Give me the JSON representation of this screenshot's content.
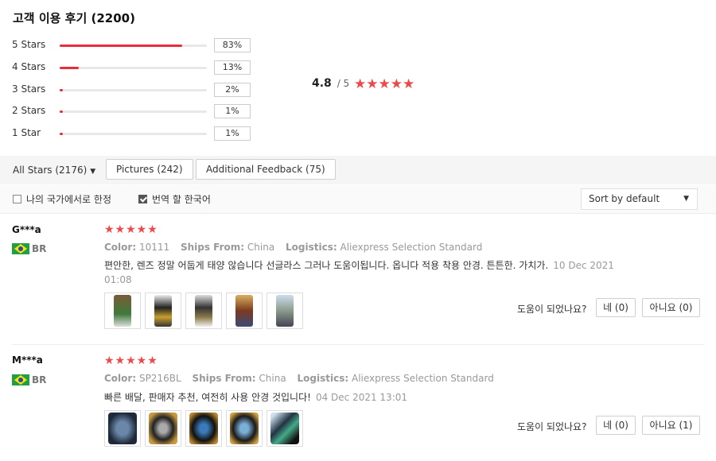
{
  "header": {
    "title": "고객 이용 후기 (2200)"
  },
  "ratings": [
    {
      "label": "5 Stars",
      "percent_text": "83%",
      "fraction": 0.83
    },
    {
      "label": "4 Stars",
      "percent_text": "13%",
      "fraction": 0.13
    },
    {
      "label": "3 Stars",
      "percent_text": "2%",
      "fraction": 0.02
    },
    {
      "label": "2 Stars",
      "percent_text": "1%",
      "fraction": 0.01
    },
    {
      "label": "1 Star",
      "percent_text": "1%",
      "fraction": 0.01
    }
  ],
  "summary": {
    "average": "4.8",
    "out_of": "/ 5",
    "stars": "★★★★★"
  },
  "filters": {
    "all_stars": "All Stars (2176)",
    "pictures": "Pictures (242)",
    "additional": "Additional Feedback (75)"
  },
  "options": {
    "country_only": "나의 국가에서로 한정",
    "country_only_checked": false,
    "translate": "번역 할 한국어",
    "translate_checked": true,
    "sort": "Sort by default"
  },
  "labels": {
    "color": "Color:",
    "ships_from": "Ships From:",
    "logistics": "Logistics:",
    "helpful_q": "도움이 되었나요?"
  },
  "reviews": [
    {
      "name": "G***a",
      "country": "BR",
      "stars": "★★★★★",
      "color": "10111",
      "ships_from": "China",
      "logistics": "Aliexpress Selection Standard",
      "text": "편안한, 렌즈 정말 어둡게 태양 않습니다 선글라스 그러나 도움이됩니다. 옵니다 적용 착용 안경. 튼튼한. 가치가.",
      "date_a": "10 Dec 2021",
      "date_b": "01:08",
      "yes": "네 (0)",
      "no": "아니요 (0)"
    },
    {
      "name": "M***a",
      "country": "BR",
      "stars": "★★★★★",
      "color": "SP216BL",
      "ships_from": "China",
      "logistics": "Aliexpress Selection Standard",
      "text": "빠른 배달, 판매자 추천, 여전히 사용 안경 것입니다!",
      "date_a": "04 Dec 2021 13:01",
      "yes": "네 (0)",
      "no": "아니요 (1)"
    }
  ],
  "colors": {
    "accent": "#e62e3b",
    "star": "#f04848"
  }
}
